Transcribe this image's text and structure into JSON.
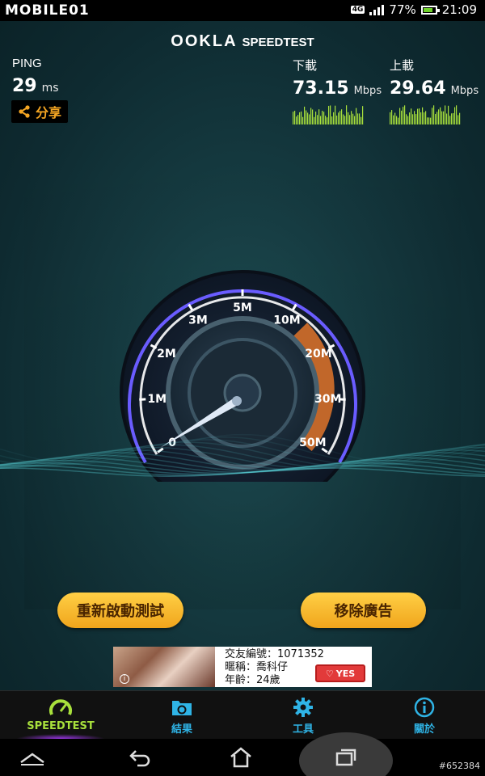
{
  "status_bar": {
    "brand": "MOBILE01",
    "network": "4G",
    "battery_percent": "77%",
    "battery_level": 0.77,
    "time": "21:09"
  },
  "header": {
    "logo": "OOKLA",
    "product": "SPEEDTEST"
  },
  "ping": {
    "label": "PING",
    "value": "29",
    "unit": "ms"
  },
  "share": {
    "icon": "share-icon",
    "label": "分享"
  },
  "download": {
    "label": "下載",
    "value": "73.15",
    "unit": "Mbps"
  },
  "upload": {
    "label": "上載",
    "value": "29.64",
    "unit": "Mbps"
  },
  "gauge": {
    "tick_labels": [
      "0",
      "1M",
      "2M",
      "3M",
      "5M",
      "10M",
      "20M",
      "30M",
      "50M"
    ],
    "needle_value": "0",
    "accent_colors": {
      "dial": "#6a5cff",
      "high_range": "#e0742a"
    }
  },
  "actions": {
    "retest_label": "重新啟動測試",
    "remove_ads_label": "移除廣告"
  },
  "ad": {
    "line1": "交友編號：1071352",
    "line2": "暱稱：喬科仔",
    "line3": "年齡：24歲",
    "button_label": "YES",
    "info_icon": "info-icon"
  },
  "tabs": [
    {
      "label": "SPEEDTEST",
      "icon": "speedometer-icon",
      "active": true
    },
    {
      "label": "結果",
      "icon": "results-folder-icon",
      "active": false
    },
    {
      "label": "工具",
      "icon": "gear-icon",
      "active": false
    },
    {
      "label": "關於",
      "icon": "info-icon",
      "active": false
    }
  ],
  "nav": {
    "home_up_icon": "chevron-up-icon",
    "back_icon": "back-icon",
    "home_icon": "home-icon",
    "recent_icon": "recent-apps-icon"
  },
  "watermark": "#652384",
  "colors": {
    "accent_green": "#a8e03c",
    "tab_blue": "#2fb4e6",
    "button_gold": "#f5b62a",
    "share_orange": "#f5a623"
  }
}
